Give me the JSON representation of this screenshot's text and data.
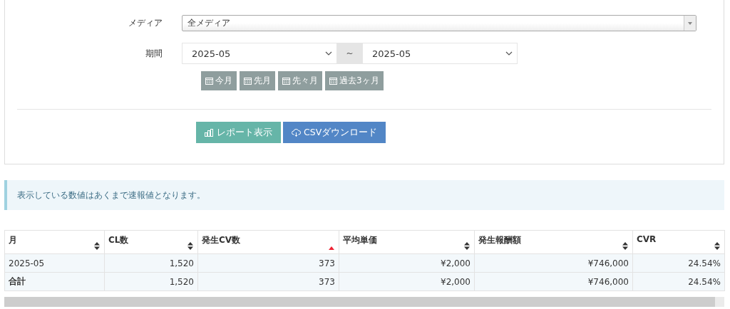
{
  "filters": {
    "media": {
      "label": "メディア",
      "value": "全メディア"
    },
    "period": {
      "label": "期間",
      "from": "2025-05",
      "separator": "~",
      "to": "2025-05"
    },
    "quick_buttons": [
      "今月",
      "先月",
      "先々月",
      "過去3ヶ月"
    ],
    "actions": [
      {
        "kind": "report",
        "label": "レポート表示"
      },
      {
        "kind": "csv",
        "label": "CSVダウンロード"
      }
    ]
  },
  "notice": "表示している数値はあくまで速報値となります。",
  "table": {
    "columns": [
      {
        "label": "月",
        "sorted": false
      },
      {
        "label": "CL数",
        "sorted": false
      },
      {
        "label": "発生CV数",
        "sorted": true
      },
      {
        "label": "平均単価",
        "sorted": false
      },
      {
        "label": "発生報酬額",
        "sorted": false
      },
      {
        "label": "CVR",
        "sorted": false
      }
    ],
    "rows": [
      {
        "kind": "data",
        "cells": [
          "2025-05",
          "1,520",
          "373",
          "¥2,000",
          "¥746,000",
          "24.54%"
        ]
      },
      {
        "kind": "total",
        "cells": [
          "合計",
          "1,520",
          "373",
          "¥2,000",
          "¥746,000",
          "24.54%"
        ]
      }
    ]
  }
}
